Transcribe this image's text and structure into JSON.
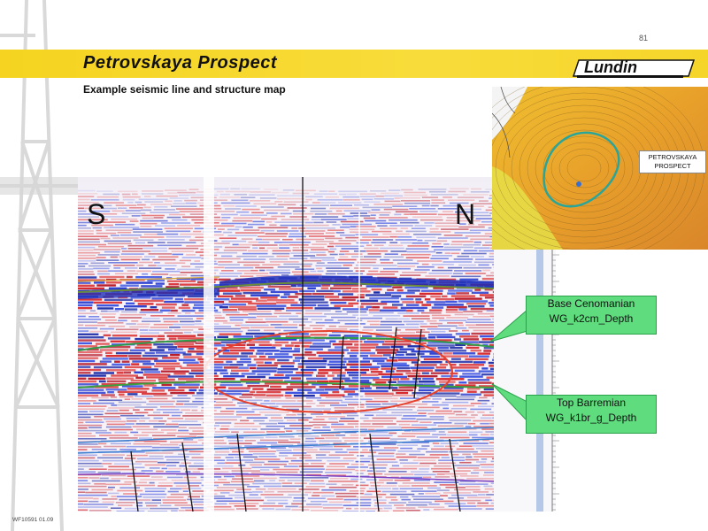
{
  "page_number": "81",
  "title": "Petrovskaya Prospect",
  "logo_text": "Lundin",
  "subtitle": "Example seismic line and structure map",
  "seismic": {
    "label_south": "S",
    "label_north": "N"
  },
  "map": {
    "prospect_label_line1": "PETROVSKAYA",
    "prospect_label_line2": "PROSPECT"
  },
  "callouts": [
    {
      "line1": "Base Cenomanian",
      "line2": "WG_k2cm_Depth"
    },
    {
      "line1": "Top Barremian",
      "line2": "WG_k1br_g_Depth"
    }
  ],
  "footer": "WF10591 01.09",
  "colors": {
    "title_band": "#f5d320",
    "callout_fill": "#5fdc7e",
    "ellipse": "#e5412c"
  }
}
